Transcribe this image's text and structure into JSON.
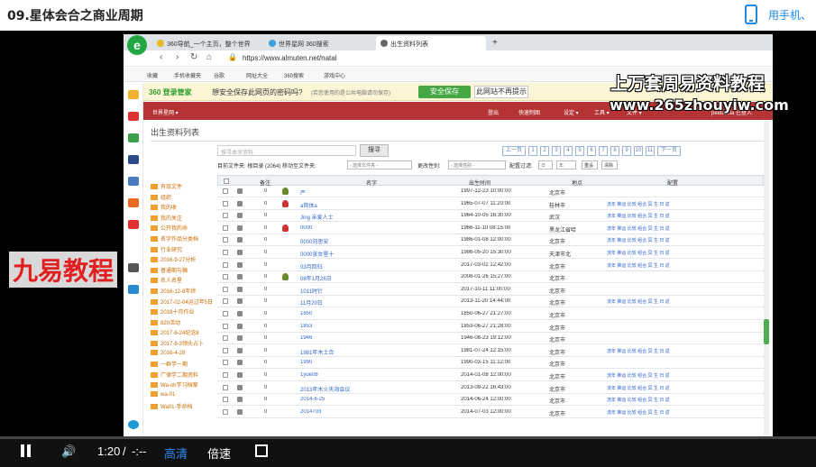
{
  "page": {
    "title": "09.星体会合之商业周期",
    "phone_link": "用手机、",
    "overlay_title": "上万套周易资料教程",
    "overlay_url": "www.265zhouyiw.com",
    "overlay_brand": "九易教程"
  },
  "browser": {
    "logo": "e",
    "tabs": [
      {
        "label": "360导航_一个主页，整个世界",
        "color": "#e8b923"
      },
      {
        "label": "世界星网 360搜索",
        "color": "#3aa0e0"
      },
      {
        "label": "出生资料列表",
        "color": "#666"
      }
    ],
    "new_tab": "+",
    "url": "https://www.almuten.net/natal",
    "bookmarks": [
      "收藏",
      "手机收藏夹",
      "谷歌",
      "网址大全",
      "360搜索",
      "游戏中心"
    ]
  },
  "password_bar": {
    "logo": "360 登录管家",
    "question": "想安全保存此网页的密码吗?",
    "hint": "(若您使用的是公共电脑请勿保存)",
    "save_label": "安全保存",
    "never_label": "此网站不再提示",
    "close": "✕"
  },
  "app_nav": {
    "left": "世界星网 ▾",
    "items": [
      "登出",
      "快速制图",
      "设定 ▾",
      "工具 ▾",
      "文件 ▾"
    ],
    "user": "peidaxxia 已登入"
  },
  "main": {
    "page_title": "出生资料列表",
    "search_placeholder": "搜寻本命资料",
    "search_button": "搜寻",
    "pager": [
      "上一页",
      "1",
      "2",
      "3",
      "4",
      "5",
      "6",
      "7",
      "8",
      "9",
      "10",
      "11",
      "下一页"
    ],
    "filter_text": "目前文件夹: 根目录 (2064)   移动至文件夹:",
    "filter_move": "- 选择文件夹 -",
    "filter_gender_label": "更改性别:",
    "filter_gender": "- 选择性别 -",
    "filter_sort_label": "配置过滤:",
    "filter_sort": "日",
    "filter_sort2": "年",
    "filter_reset": "重设",
    "filter_clear": "清除"
  },
  "sidebar": [
    "有效文件",
    "组织",
    "我的收",
    "我的关注",
    "公开我的命",
    "名字作品分类档",
    "行业研究",
    "2016-9-27分析",
    "普通期与稿",
    "名人名星",
    "2016-12-8年终",
    "2017-02-04运过年5日",
    "2018十月作业",
    "820活动",
    "2017-6-24纪念8",
    "2017-8-3领头占卜",
    "2016-4-28",
    "一群学一期",
    "广律学二期资料",
    "Wa-oh学习档案",
    "wa-01",
    "Wa01-手命档"
  ],
  "table": {
    "headers": [
      "",
      "",
      "备注",
      "",
      "名字",
      "出生时间",
      "地点",
      "配置"
    ],
    "rows": [
      {
        "remark": "0",
        "icon": "person",
        "name": "严",
        "time": "1997-12-23 10:00:00",
        "place": "北京市",
        "ops": ""
      },
      {
        "remark": "0",
        "icon": "red",
        "name": "a简体a",
        "time": "1965-07-07 11:20:00",
        "place": "桂林市",
        "ops": "流年 推运 比较 组合 冥 生 日 返"
      },
      {
        "remark": "0",
        "icon": "",
        "name": "Jing 亲爱人士",
        "time": "1964-10-05 16:30:00",
        "place": "武汉",
        "ops": "流年 推运 比较 组合 冥 生 日 返"
      },
      {
        "remark": "0",
        "icon": "red",
        "name": "0000",
        "time": "1966-11-10 08:15:00",
        "place": "黑龙江省哈",
        "ops": "流年 推运 比较 组合 冥 生 日 返"
      },
      {
        "remark": "0",
        "icon": "",
        "name": "0000刘思安",
        "time": "1986-01-08 12:00:00",
        "place": "北京市",
        "ops": "流年 推运 比较 组合 冥 生 日 返"
      },
      {
        "remark": "0",
        "icon": "",
        "name": "0000张女星十",
        "time": "1986-05-20 15:30:00",
        "place": "天津市北",
        "ops": "流年 推运 比较 组合 冥 生 日 返"
      },
      {
        "remark": "0",
        "icon": "",
        "name": "03月回归",
        "time": "2017-03-02 12:42:00",
        "place": "北京市",
        "ops": "流年 推运 比较 组合 冥 生 日 返"
      },
      {
        "remark": "0",
        "icon": "person",
        "name": "08年1月26日",
        "time": "2008-01-26 15:27:00",
        "place": "北京市",
        "ops": ""
      },
      {
        "remark": "0",
        "icon": "",
        "name": "1011时针",
        "time": "2017-10-11 11:00:00",
        "place": "北京市",
        "ops": ""
      },
      {
        "remark": "0",
        "icon": "",
        "name": "11月20日",
        "time": "2013-11-20 14:44:00",
        "place": "北京市",
        "ops": "流年 推运 比较 组合 冥 生 日 返"
      },
      {
        "remark": "0",
        "icon": "",
        "name": "1850",
        "time": "1850-06-27 21:27:00",
        "place": "北京市",
        "ops": ""
      },
      {
        "remark": "0",
        "icon": "",
        "name": "1853",
        "time": "1853-06-27 21:28:00",
        "place": "北京市",
        "ops": ""
      },
      {
        "remark": "0",
        "icon": "",
        "name": "1946",
        "time": "1946-08-23 19:12:00",
        "place": "北京市",
        "ops": ""
      },
      {
        "remark": "0",
        "icon": "",
        "name": "1981年木土合",
        "time": "1981-07-24 12:15:00",
        "place": "北京市",
        "ops": "流年 推运 比较 组合 冥 生 日 返"
      },
      {
        "remark": "0",
        "icon": "",
        "name": "1990",
        "time": "1990-03-15 11:12:00",
        "place": "北京市",
        "ops": ""
      },
      {
        "remark": "0",
        "icon": "",
        "name": "1yue08",
        "time": "2014-01-08 12:00:00",
        "place": "北京市",
        "ops": "流年 推运 比较 组合 冥 生 日 返"
      },
      {
        "remark": "0",
        "icon": "",
        "name": "2013年木火天海会议",
        "time": "2013-09-22 16:43:00",
        "place": "北京市",
        "ops": "流年 推运 比较 组合 冥 生 日 返"
      },
      {
        "remark": "0",
        "icon": "",
        "name": "2014-6-25",
        "time": "2014-06-24 12:00:00",
        "place": "北京市",
        "ops": "流年 推运 比较 组合 冥 生 日 返"
      },
      {
        "remark": "0",
        "icon": "",
        "name": "2014703",
        "time": "2014-07-03 12:00:00",
        "place": "北京市",
        "ops": "流年 推运 比较 组合 冥 生 日 返"
      }
    ]
  },
  "player": {
    "time": "1:20",
    "separator": "/",
    "duration": "-:--",
    "quality": "高清",
    "speed": "倍速",
    "progress": 0
  }
}
